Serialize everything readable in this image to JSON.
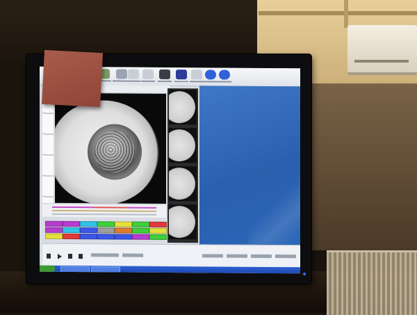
{
  "scene": {
    "description_free": true
  },
  "screen": {
    "visible_text_legible": false
  },
  "colors": {
    "screen_blue": "#2f67b6",
    "sticky_note": "#9c4f40",
    "taskbar": "#2456c4",
    "tag_palette": [
      "#b73bd1",
      "#2ec3e8",
      "#3fcf3b",
      "#e8e03a",
      "#e13b3b",
      "#e07a2e",
      "#3b57e8",
      "#9d9d9d"
    ]
  }
}
